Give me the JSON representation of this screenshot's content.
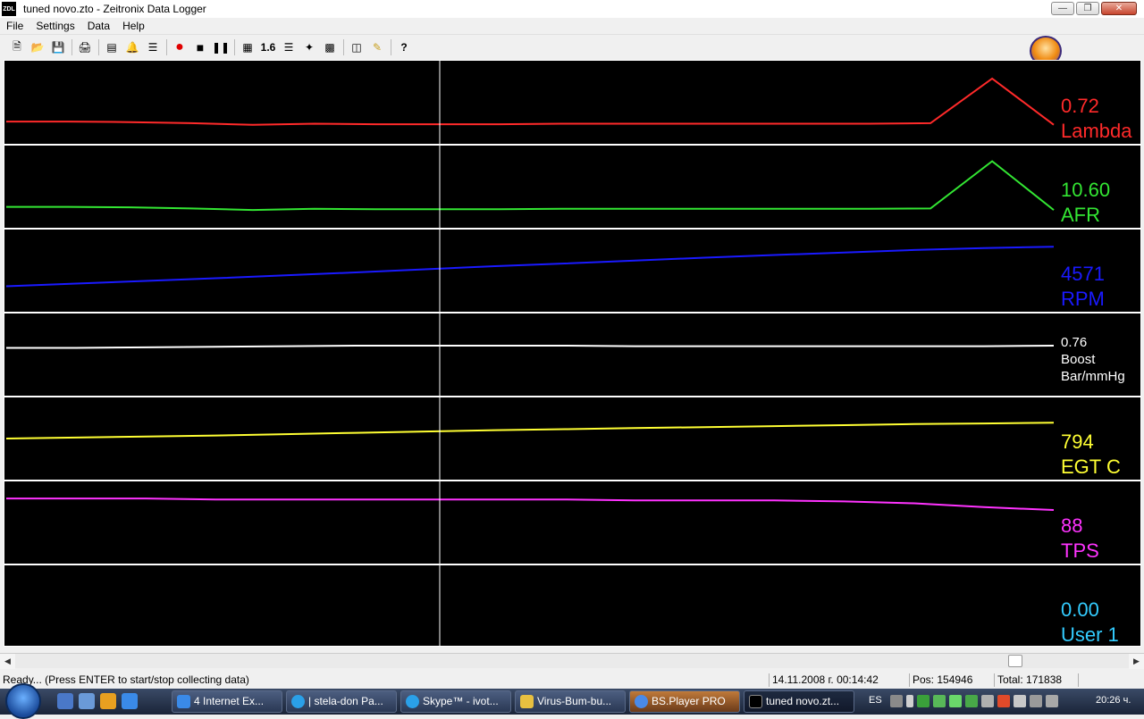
{
  "window": {
    "icon_text": "ZDL",
    "title": "tuned novo.zto - Zeitronix Data Logger"
  },
  "menu": [
    "File",
    "Settings",
    "Data",
    "Help"
  ],
  "toolbar": {
    "zoom_label": "1.6"
  },
  "channels": [
    {
      "value": "0.72",
      "name": "Lambda",
      "color": "#ff2a2a"
    },
    {
      "value": "10.60",
      "name": "AFR",
      "color": "#33e633"
    },
    {
      "value": "4571",
      "name": "RPM",
      "color": "#1a1aff"
    },
    {
      "value": "0.76",
      "name": "Boost",
      "unit": "Bar/mmHg",
      "color": "#ffffff"
    },
    {
      "value": "794",
      "name": "EGT C",
      "color": "#ffff33"
    },
    {
      "value": "88",
      "name": "TPS",
      "color": "#ff33ff"
    },
    {
      "value": "0.00",
      "name": "User 1",
      "color": "#33ccff"
    }
  ],
  "chart_data": {
    "type": "line",
    "series": [
      {
        "name": "Lambda",
        "values": [
          0.78,
          0.78,
          0.77,
          0.75,
          0.72,
          0.74,
          0.73,
          0.73,
          0.73,
          0.74,
          0.74,
          0.74,
          0.74,
          0.74,
          0.74,
          0.75,
          1.6,
          0.72
        ]
      },
      {
        "name": "AFR",
        "values": [
          11.4,
          11.4,
          11.3,
          11.0,
          10.6,
          10.9,
          10.8,
          10.8,
          10.8,
          10.9,
          10.9,
          10.9,
          10.9,
          10.9,
          10.9,
          11.0,
          23.0,
          10.6
        ]
      },
      {
        "name": "RPM",
        "values": [
          2800,
          2920,
          3040,
          3160,
          3290,
          3420,
          3560,
          3700,
          3820,
          3950,
          4080,
          4200,
          4310,
          4420,
          4510,
          4571
        ]
      },
      {
        "name": "Boost",
        "values": [
          0.72,
          0.72,
          0.73,
          0.74,
          0.75,
          0.76,
          0.76,
          0.76,
          0.76,
          0.75,
          0.75,
          0.75,
          0.75,
          0.75,
          0.75,
          0.76
        ]
      },
      {
        "name": "EGT C",
        "values": [
          700,
          706,
          712,
          718,
          726,
          734,
          742,
          750,
          756,
          762,
          768,
          774,
          780,
          786,
          790,
          794
        ]
      },
      {
        "name": "TPS",
        "values": [
          100,
          100,
          100,
          99,
          99,
          99,
          99,
          99,
          99,
          98,
          98,
          98,
          97,
          95,
          91,
          88
        ]
      },
      {
        "name": "User 1",
        "values": [
          0,
          0,
          0,
          0,
          0,
          0,
          0,
          0,
          0,
          0,
          0,
          0,
          0,
          0,
          0,
          0
        ]
      }
    ]
  },
  "status": {
    "message": "Ready... (Press ENTER to start/stop collecting data)",
    "datetime": "14.11.2008 г. 00:14:42",
    "pos": "Pos: 154946",
    "total": "Total: 171838"
  },
  "taskbar": {
    "tasks": [
      "4 Internet Ex...",
      "| stela-don Pa...",
      "Skype™ - ivot...",
      "Virus-Bum-bu...",
      "BS.Player PRO",
      "tuned novo.zt..."
    ],
    "lang": "ES",
    "clock": "20:26 ч."
  }
}
